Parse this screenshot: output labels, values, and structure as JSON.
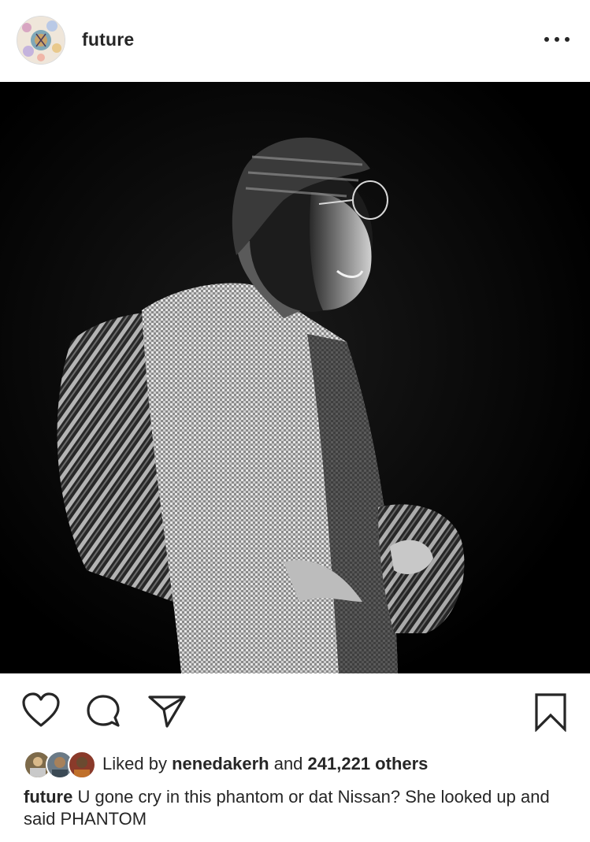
{
  "post": {
    "username": "future",
    "more_icon": "more-horizontal-icon",
    "photo_alt": "Black and white photo of performer in tweed coat"
  },
  "actions": {
    "like_icon": "heart-icon",
    "comment_icon": "comment-icon",
    "share_icon": "send-icon",
    "save_icon": "bookmark-icon"
  },
  "likes": {
    "prefix": "Liked by",
    "first_liker": "nenedakerh",
    "middle": "and",
    "others_count": "241,221 others"
  },
  "caption": {
    "username": "future",
    "text": "U gone cry in this phantom or dat Nissan? She looked up and said PHANTOM"
  },
  "colors": {
    "text": "#262626",
    "background": "#ffffff",
    "border": "#dbdbdb",
    "photo_bg": "#000000"
  }
}
